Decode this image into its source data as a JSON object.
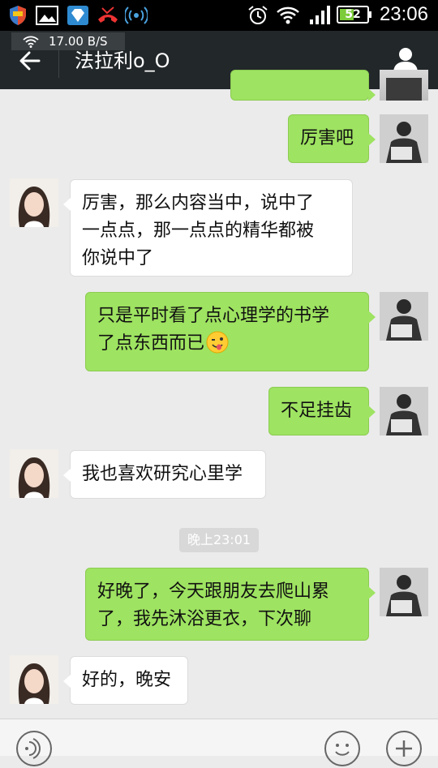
{
  "status_bar": {
    "time": "23:06",
    "battery_level": "52",
    "battery_fraction": 0.52,
    "icons": [
      "shield-icon",
      "gallery-icon",
      "diamond-icon",
      "missed-call-icon",
      "signal-broadcast-icon",
      "alarm-icon",
      "wifi-icon",
      "cell-signal-icon"
    ]
  },
  "header": {
    "network_speed": "17.00 B/S",
    "title": "法拉利o_O",
    "back_icon": "back-arrow-icon",
    "profile_icon": "person-icon"
  },
  "messages": [
    {
      "side": "right",
      "text": "厉害吧"
    },
    {
      "side": "left",
      "lines": [
        "厉害，那么内容当中，说中了",
        "一点点，那一点点的精华都被",
        "你说中了"
      ]
    },
    {
      "side": "right",
      "lines": [
        "只是平时看了点心理学的书学",
        "了点东西而已"
      ],
      "emoji": "winking-face-tongue-emoji"
    },
    {
      "side": "right",
      "text": "不足挂齿"
    },
    {
      "side": "left",
      "text": "我也喜欢研究心里学"
    },
    {
      "side": "right",
      "lines": [
        "好晚了，今天跟朋友去爬山累",
        "了，我先沐浴更衣，下次聊"
      ]
    },
    {
      "side": "left",
      "text": "好的，晚安"
    }
  ],
  "timestamp": "晚上23:01",
  "colors": {
    "sent_bubble": "#9ee361",
    "received_bubble": "#ffffff",
    "chat_background": "#ebebeb",
    "title_bar": "#22272a"
  },
  "bottom_bar": {
    "icons": [
      "voice-icon",
      "emoji-icon",
      "plus-icon"
    ]
  }
}
